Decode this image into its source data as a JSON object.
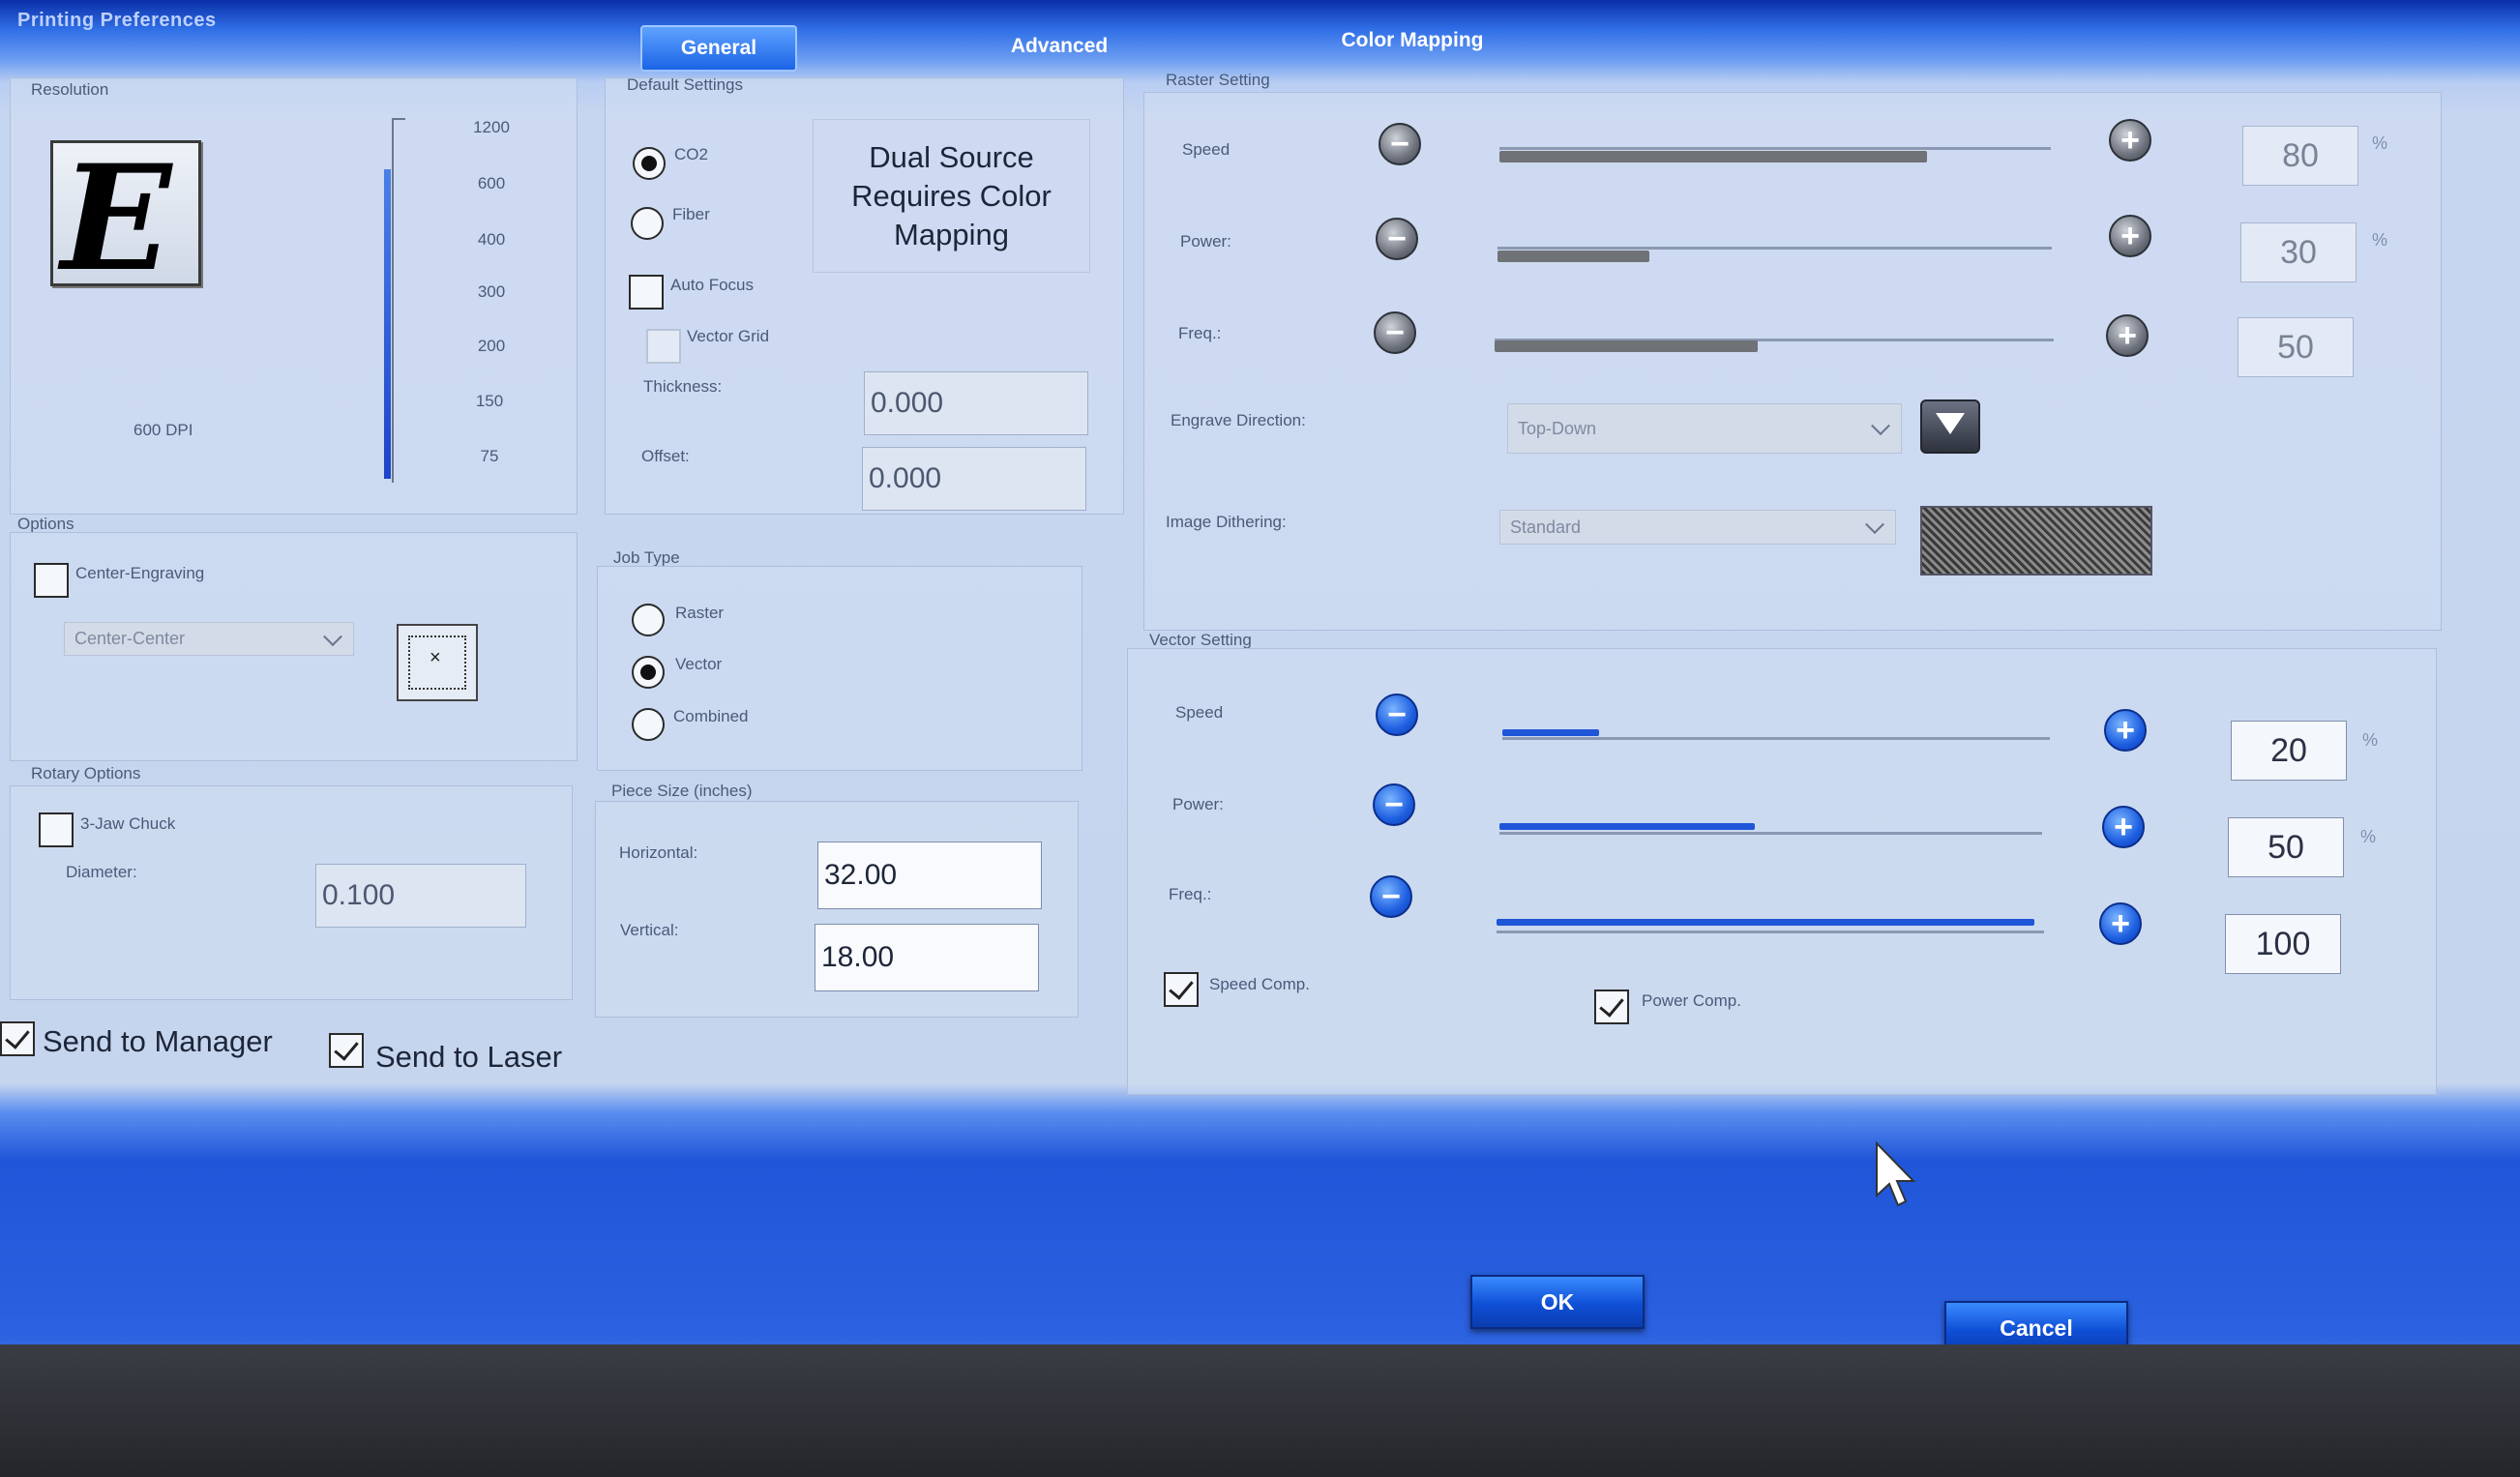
{
  "window": {
    "title": "Printing Preferences"
  },
  "tabs": [
    {
      "label": "General",
      "active": true
    },
    {
      "label": "Advanced",
      "active": false
    },
    {
      "label": "Color Mapping",
      "active": false
    }
  ],
  "resolution": {
    "label": "Resolution",
    "current": "600 DPI",
    "ticks": [
      "1200",
      "600",
      "400",
      "300",
      "200",
      "150",
      "75"
    ],
    "logo_letter": "E"
  },
  "default_settings": {
    "label": "Default Settings",
    "co2": "CO2",
    "fiber": "Fiber",
    "auto_focus": "Auto Focus",
    "vector_grid": "Vector Grid",
    "thickness_label": "Thickness:",
    "thickness_value": "0.000",
    "offset_label": "Offset:",
    "offset_value": "0.000",
    "dual_source_note": "Dual Source Requires Color Mapping"
  },
  "options": {
    "label": "Options",
    "center_engraving": "Center-Engraving",
    "center_select": "Center-Center"
  },
  "job_type": {
    "label": "Job Type",
    "raster": "Raster",
    "vector": "Vector",
    "combined": "Combined",
    "selected": "Vector"
  },
  "rotary": {
    "label": "Rotary Options",
    "chuck": "3-Jaw Chuck",
    "diameter_label": "Diameter:",
    "diameter_value": "0.100"
  },
  "piece_size": {
    "label": "Piece Size (inches)",
    "horizontal_label": "Horizontal:",
    "horizontal_value": "32.00",
    "vertical_label": "Vertical:",
    "vertical_value": "18.00"
  },
  "send": {
    "manager": "Send to Manager",
    "laser": "Send to Laser"
  },
  "raster_setting": {
    "label": "Raster Setting",
    "speed_label": "Speed",
    "speed_value": "80",
    "power_label": "Power:",
    "power_value": "30",
    "freq_label": "Freq.:",
    "freq_value": "50",
    "pct": "%",
    "engrave_direction_label": "Engrave Direction:",
    "engrave_direction_value": "Top-Down",
    "image_dithering_label": "Image Dithering:",
    "image_dithering_value": "Standard"
  },
  "vector_setting": {
    "label": "Vector Setting",
    "speed_label": "Speed",
    "speed_value": "20",
    "power_label": "Power:",
    "power_value": "50",
    "freq_label": "Freq.:",
    "freq_value": "100",
    "pct": "%",
    "speed_comp": "Speed Comp.",
    "power_comp": "Power Comp."
  },
  "buttons": {
    "ok": "OK",
    "cancel": "Cancel"
  },
  "colors": {
    "accent": "#1f56d8",
    "panel": "#c6d5ee",
    "title_bar": "#0b2fa8"
  }
}
